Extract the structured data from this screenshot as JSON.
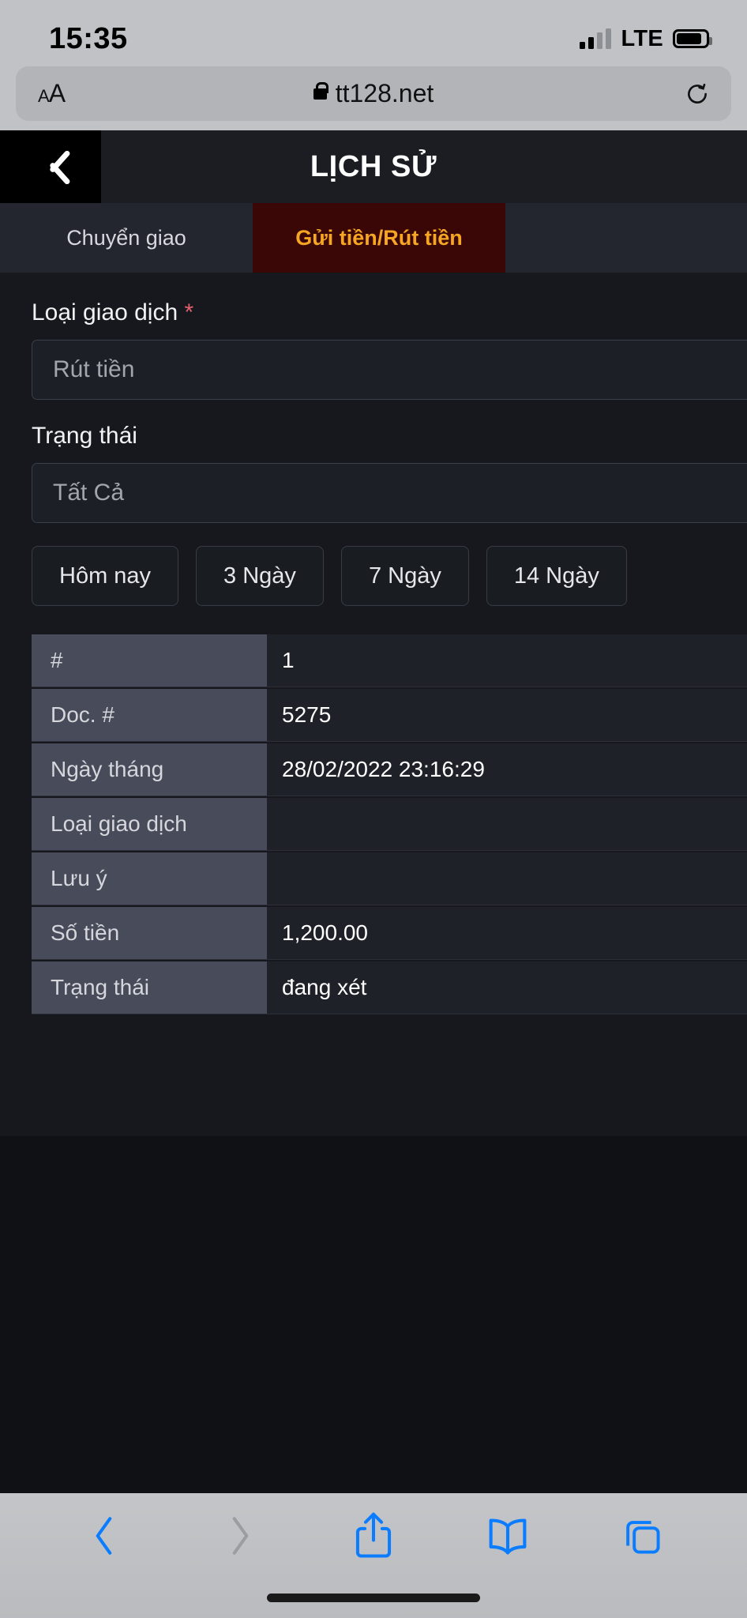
{
  "status_bar": {
    "time": "15:35",
    "network": "LTE",
    "signal_icon": "cellular-signal-icon",
    "battery_icon": "battery-icon"
  },
  "browser": {
    "text_size_label": "AA",
    "lock_icon": "lock-icon",
    "url": "tt128.net",
    "reload_icon": "reload-icon",
    "toolbar": {
      "back_icon": "chevron-left-icon",
      "forward_icon": "chevron-right-icon",
      "share_icon": "share-icon",
      "bookmarks_icon": "book-icon",
      "tabs_icon": "tabs-icon",
      "back_color": "#0a7cff",
      "forward_color": "#9b9da1"
    }
  },
  "app_header": {
    "back_icon": "chevron-left-icon",
    "title": "LỊCH SỬ"
  },
  "tabs": {
    "active_bg": "#3a0606",
    "active_color": "#f5a623",
    "items": [
      {
        "label": "Chuyển giao",
        "active": false
      },
      {
        "label": "Gửi tiền/Rút tiền",
        "active": true
      }
    ]
  },
  "form": {
    "transaction_type": {
      "label": "Loại giao dịch",
      "required_marker": "*",
      "value": "Rút tiền"
    },
    "status": {
      "label": "Trạng thái",
      "value": "Tất Cả"
    },
    "range_buttons": [
      {
        "label": "Hôm nay"
      },
      {
        "label": "3 Ngày"
      },
      {
        "label": "7 Ngày"
      },
      {
        "label": "14 Ngày"
      }
    ]
  },
  "table": {
    "rows": [
      {
        "key": "#",
        "value": "1"
      },
      {
        "key": "Doc. #",
        "value": "5275"
      },
      {
        "key": "Ngày tháng",
        "value": "28/02/2022 23:16:29"
      },
      {
        "key": "Loại giao dịch",
        "value": ""
      },
      {
        "key": "Lưu ý",
        "value": ""
      },
      {
        "key": "Số tiền",
        "value": "1,200.00"
      },
      {
        "key": "Trạng thái",
        "value": "đang xét"
      }
    ]
  }
}
